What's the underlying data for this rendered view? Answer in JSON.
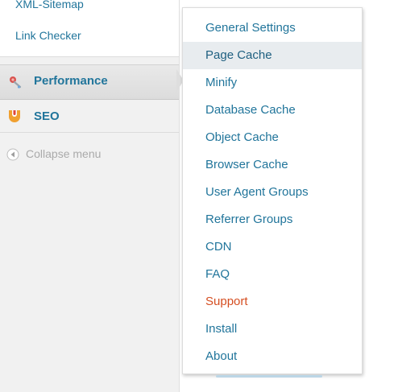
{
  "sidebar": {
    "submenu_links": [
      {
        "label": "XML-Sitemap"
      },
      {
        "label": "Link Checker"
      }
    ],
    "menu_items": [
      {
        "label": "Performance",
        "icon": "performance-icon",
        "state": "hover"
      },
      {
        "label": "SEO",
        "icon": "seo-icon"
      }
    ],
    "collapse": {
      "label": "Collapse menu",
      "icon": "collapse-arrow-icon"
    }
  },
  "flyout": {
    "items": [
      {
        "label": "General Settings"
      },
      {
        "label": "Page Cache",
        "state": "hover"
      },
      {
        "label": "Minify"
      },
      {
        "label": "Database Cache"
      },
      {
        "label": "Object Cache"
      },
      {
        "label": "Browser Cache"
      },
      {
        "label": "User Agent Groups"
      },
      {
        "label": "Referrer Groups"
      },
      {
        "label": "CDN"
      },
      {
        "label": "FAQ"
      },
      {
        "label": "Support",
        "color": "#d54e21"
      },
      {
        "label": "Install"
      },
      {
        "label": "About"
      }
    ]
  },
  "colors": {
    "link": "#21759b",
    "support": "#d54e21",
    "sidebar_bg": "#f1f1f1",
    "muted": "#aaaaaa"
  }
}
